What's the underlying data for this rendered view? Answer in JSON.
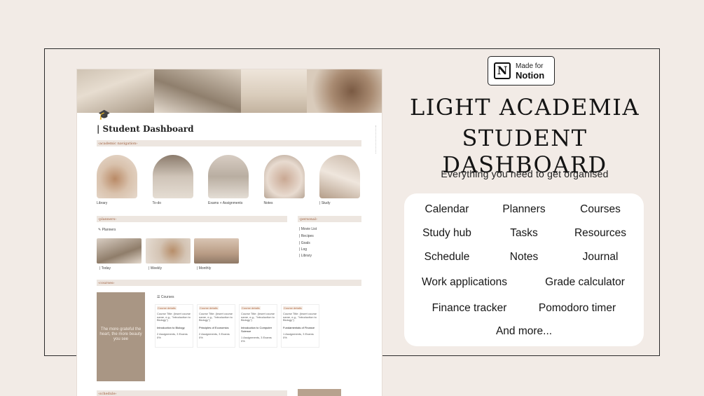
{
  "badge": {
    "line1": "Made for",
    "line2": "Notion",
    "logo": "N"
  },
  "headline": {
    "line1": "LIGHT ACADEMIA",
    "line2": "STUDENT DASHBOARD"
  },
  "tagline": "Everything you need to get organised",
  "features": [
    "Calendar",
    "Planners",
    "Courses",
    "Study hub",
    "Tasks",
    "Resources",
    "Schedule",
    "Notes",
    "Journal",
    "Work applications",
    "Grade calculator",
    "Finance tracker",
    "Pomodoro timer",
    "And more..."
  ],
  "dashboard": {
    "title": "| Student Dashboard",
    "page_icon": "graduation-cap-icon",
    "sections": {
      "academic_navigation": "‹academic navigation›",
      "planners": "‹planners›",
      "personal": "‹personal›",
      "courses": "‹courses›",
      "schedule": "‹schedule›"
    },
    "nav_items": [
      "Library",
      "To-do",
      "Exams + Assignments",
      "Notes",
      "| Study"
    ],
    "planners_link": "Planners",
    "planner_items": [
      "| Today",
      "| Weekly",
      "| Monthly"
    ],
    "personal_items": [
      "| Movie List",
      "| Recipes",
      "| Goals",
      "| Log",
      "| Library"
    ],
    "courses_header": "Courses",
    "quote": "The more grateful the heart, the more beauty you see",
    "course_cards": [
      {
        "tag": "Course details",
        "title": "Course Title: (Insert course name, e.g., \"Introduction to Biology\")",
        "name": "Introduction to Biology",
        "meta": "2 Assignments, 3 Exams",
        "pct": "0%"
      },
      {
        "tag": "Course details",
        "title": "Course Title: (Insert course name, e.g., \"Introduction to Biology\")",
        "name": "Principles of Economics",
        "meta": "2 Assignments, 3 Exams",
        "pct": "0%"
      },
      {
        "tag": "Course details",
        "title": "Course Title: (Insert course name, e.g., \"Introduction to Biology\")",
        "name": "Introduction to Computer Science",
        "meta": "1 Assignments, 3 Exams",
        "pct": "0%"
      },
      {
        "tag": "Course details",
        "title": "Course Title: (Insert course name, e.g., \"Introduction to Biology\")",
        "name": "Fundamentals of Finance",
        "meta": "1 Assignments, 3 Exams",
        "pct": "0%"
      }
    ]
  }
}
